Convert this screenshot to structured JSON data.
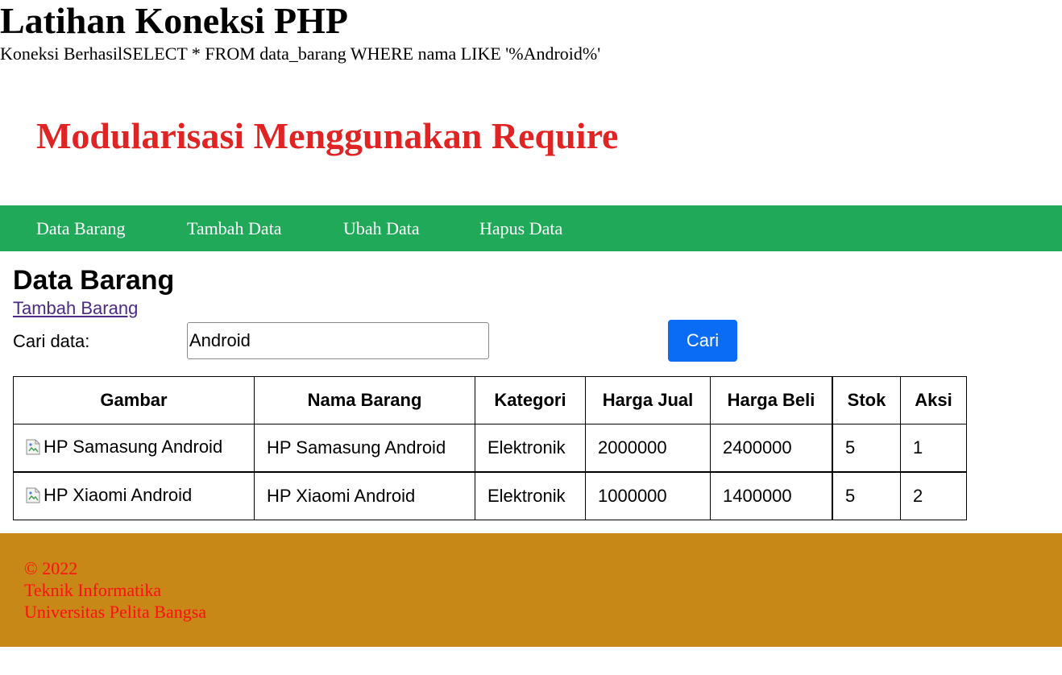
{
  "page": {
    "title": "Latihan Koneksi PHP",
    "connection_status": "Koneksi BerhasilSELECT * FROM data_barang WHERE nama LIKE '%Android%'"
  },
  "header": {
    "title": "Modularisasi Menggunakan Require",
    "color": "#e02424"
  },
  "nav": {
    "background": "#21a95a",
    "items": [
      {
        "label": "Data Barang"
      },
      {
        "label": "Tambah Data"
      },
      {
        "label": "Ubah Data"
      },
      {
        "label": "Hapus Data"
      }
    ]
  },
  "main": {
    "section_title": "Data Barang",
    "add_link": "Tambah Barang",
    "search": {
      "label": "Cari data:",
      "value": "Android",
      "button_label": "Cari",
      "button_color": "#0a6cf5"
    },
    "table": {
      "headers": [
        "Gambar",
        "Nama Barang",
        "Kategori",
        "Harga Jual",
        "Harga Beli",
        "Stok",
        "Aksi"
      ],
      "rows": [
        {
          "image_alt": "HP Samasung Android",
          "nama": "HP Samasung Android",
          "kategori": "Elektronik",
          "harga_jual": "2000000",
          "harga_beli": "2400000",
          "stok": "5",
          "aksi": "1"
        },
        {
          "image_alt": "HP Xiaomi Android",
          "nama": "HP Xiaomi Android",
          "kategori": "Elektronik",
          "harga_jual": "1000000",
          "harga_beli": "1400000",
          "stok": "5",
          "aksi": "2"
        }
      ]
    }
  },
  "footer": {
    "background": "#c78818",
    "text_color": "#ff0f0f",
    "copyright": "© 2022",
    "department": "Teknik Informatika",
    "university": "Universitas Pelita Bangsa"
  },
  "icons": {
    "broken_image": "broken-image-icon"
  }
}
